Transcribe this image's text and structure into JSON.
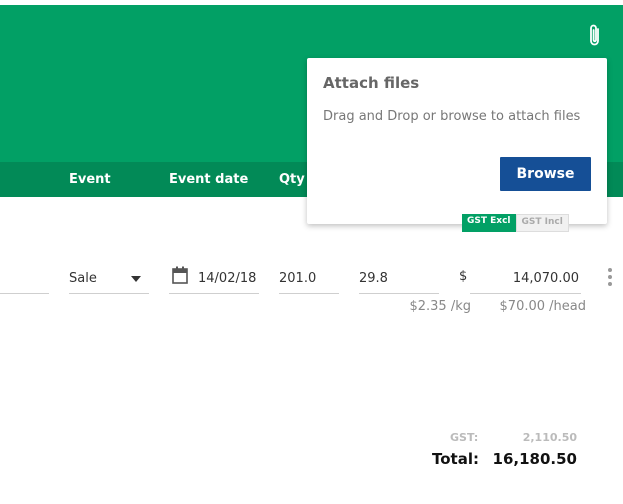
{
  "header": {
    "columns": [
      "Event",
      "Event date",
      "Qty"
    ],
    "attach_icon": "paperclip-icon"
  },
  "attach_popover": {
    "title": "Attach files",
    "message": "Drag and Drop or browse to attach files",
    "browse_label": "Browse"
  },
  "gst_toggle": {
    "options": [
      "GST Excl",
      "GST Incl"
    ],
    "selected": "GST Excl"
  },
  "row": {
    "event": "Sale",
    "event_date": "14/02/18",
    "qty": "201.0",
    "weight": "29.8",
    "currency_symbol": "$",
    "amount": "14,070.00",
    "price_per_kg": "$2.35 /kg",
    "price_per_head": "$70.00 /head"
  },
  "summary": {
    "gst_label": "GST:",
    "gst_value": "2,110.50",
    "total_label": "Total:",
    "total_value": "16,180.50"
  },
  "colors": {
    "header_green": "#02a065",
    "column_bar_green": "#028a57",
    "browse_blue": "#154f96"
  }
}
